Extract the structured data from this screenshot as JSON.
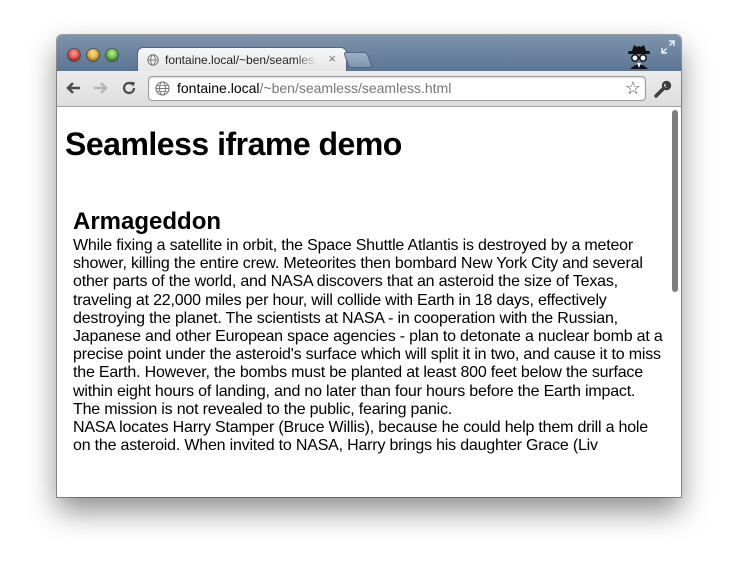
{
  "browser": {
    "tab_title": "fontaine.local/~ben/seamless/seamless.html",
    "tab_close": "×",
    "url_host": "fontaine.local",
    "url_path": "/~ben/seamless/seamless.html",
    "star": "☆"
  },
  "page": {
    "title": "Seamless iframe demo",
    "iframe": {
      "heading": "Armageddon",
      "paragraphs": [
        "While fixing a satellite in orbit, the Space Shuttle Atlantis is destroyed by a meteor shower, killing the entire crew. Meteorites then bombard New York City and several other parts of the world, and NASA discovers that an asteroid the size of Texas, traveling at 22,000 miles per hour, will collide with Earth in 18 days, effectively destroying the planet. The scientists at NASA - in cooperation with the Russian, Japanese and other European space agencies - plan to detonate a nuclear bomb at a precise point under the asteroid's surface which will split it in two, and cause it to miss the Earth. However, the bombs must be planted at least 800 feet below the surface within eight hours of landing, and no later than four hours before the Earth impact. The mission is not revealed to the public, fearing panic.",
        "NASA locates Harry Stamper (Bruce Willis), because he could help them drill a hole on the asteroid. When invited to NASA, Harry brings his daughter Grace (Liv"
      ]
    }
  },
  "colors": {
    "titlebar": "#6a839f",
    "close": "#d8362b",
    "minimize": "#d79b17",
    "maximize": "#52a82b"
  }
}
